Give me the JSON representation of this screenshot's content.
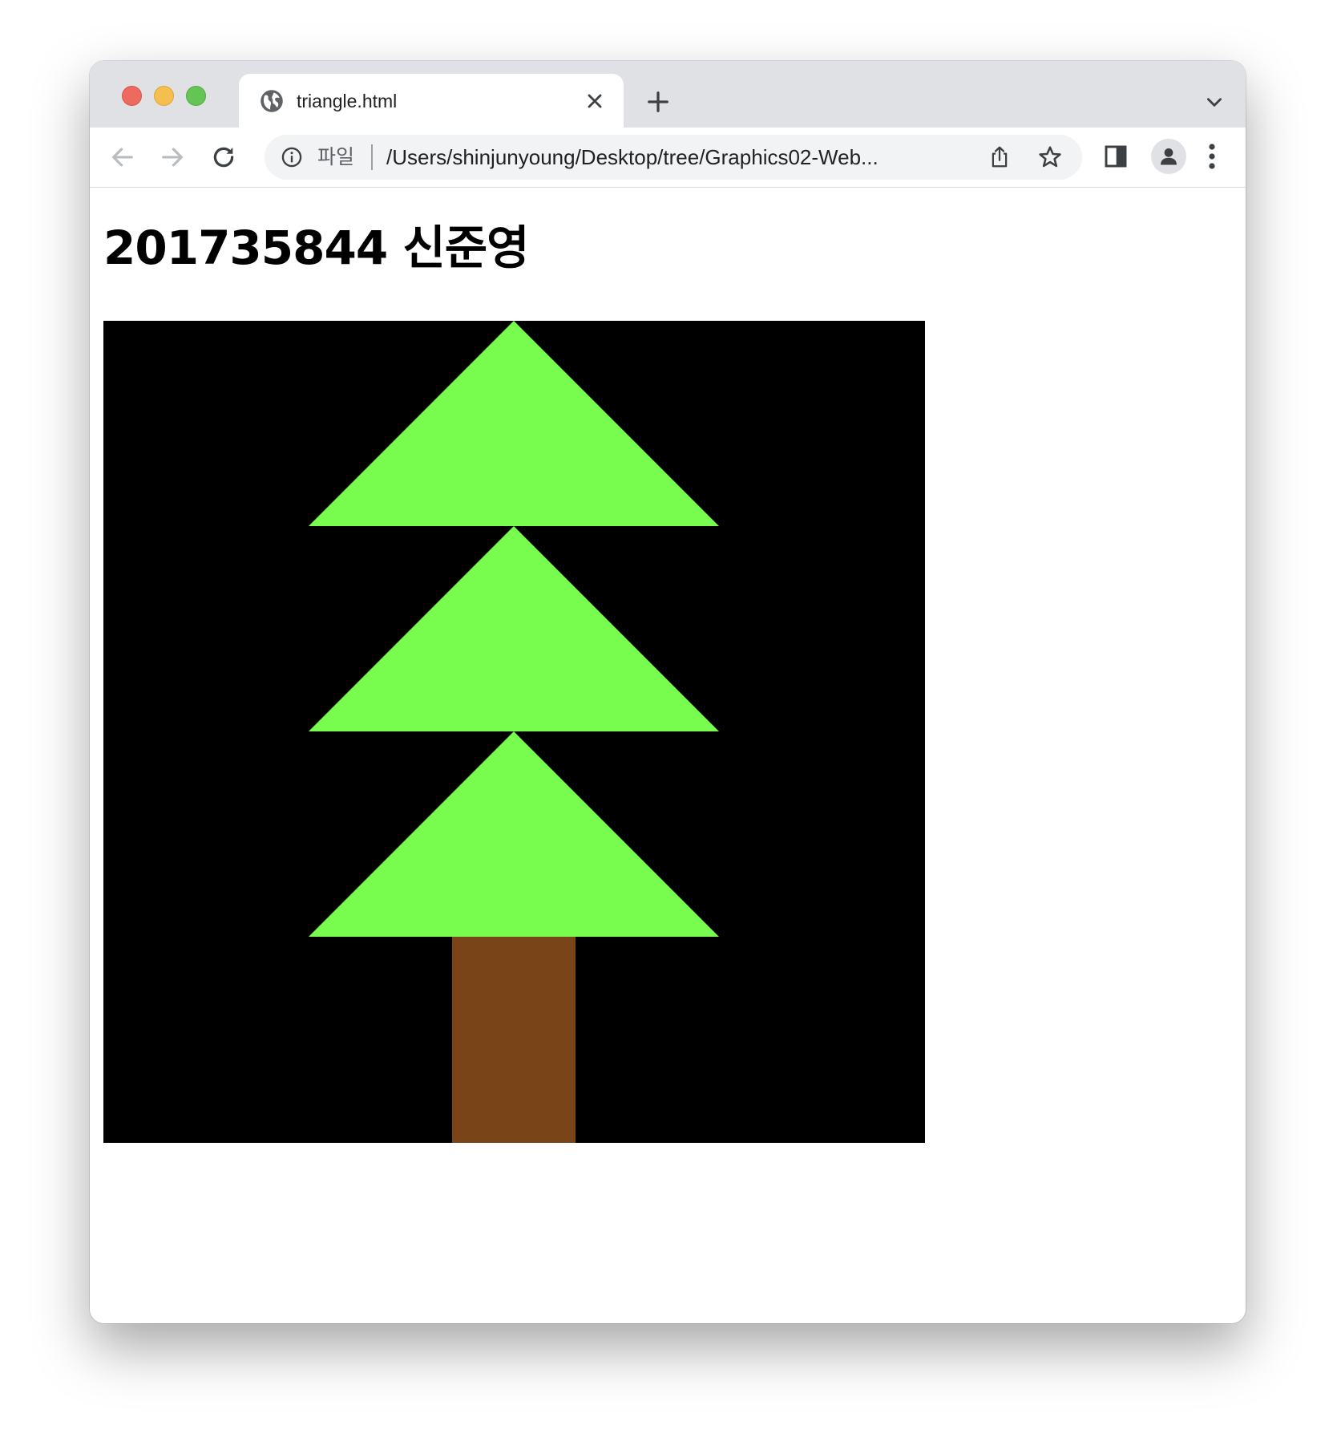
{
  "browser": {
    "tab": {
      "title": "triangle.html",
      "icon": "globe-icon",
      "close_icon": "close-icon"
    },
    "new_tab_icon": "plus-icon",
    "tab_search_icon": "chevron-down-icon",
    "nav": {
      "back_icon": "back-arrow-icon",
      "forward_icon": "forward-arrow-icon",
      "reload_icon": "reload-icon"
    },
    "omnibox": {
      "info_icon": "info-icon",
      "scheme_label": "파일",
      "url": "/Users/shinjunyoung/Desktop/tree/Graphics02-Web...",
      "share_icon": "share-icon",
      "bookmark_icon": "star-icon"
    },
    "side_panel_icon": "side-panel-icon",
    "profile_icon": "person-icon",
    "menu_icon": "kebab-menu-icon"
  },
  "page": {
    "heading": "201735844 신준영",
    "canvas": {
      "background": "#000000",
      "foliage_color": "#78fd4f",
      "trunk_color": "#7a4419"
    }
  }
}
